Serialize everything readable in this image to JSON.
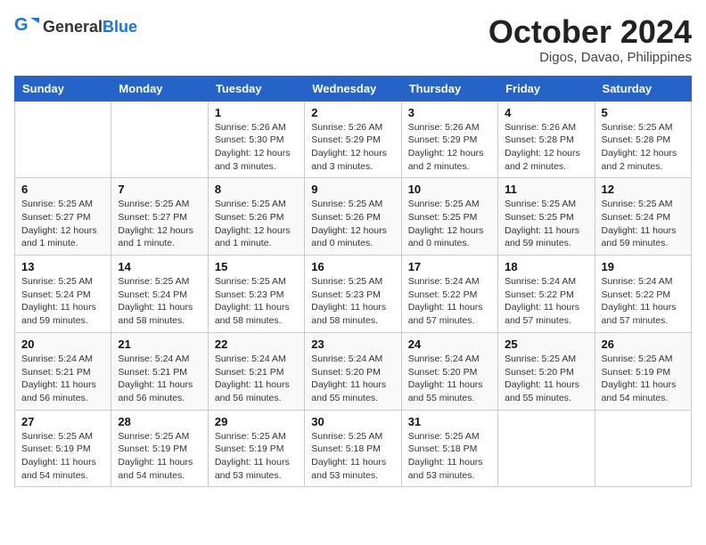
{
  "header": {
    "logo_general": "General",
    "logo_blue": "Blue",
    "month": "October 2024",
    "location": "Digos, Davao, Philippines"
  },
  "days_of_week": [
    "Sunday",
    "Monday",
    "Tuesday",
    "Wednesday",
    "Thursday",
    "Friday",
    "Saturday"
  ],
  "weeks": [
    [
      {
        "day": "",
        "info": ""
      },
      {
        "day": "",
        "info": ""
      },
      {
        "day": "1",
        "info": "Sunrise: 5:26 AM\nSunset: 5:30 PM\nDaylight: 12 hours and 3 minutes."
      },
      {
        "day": "2",
        "info": "Sunrise: 5:26 AM\nSunset: 5:29 PM\nDaylight: 12 hours and 3 minutes."
      },
      {
        "day": "3",
        "info": "Sunrise: 5:26 AM\nSunset: 5:29 PM\nDaylight: 12 hours and 2 minutes."
      },
      {
        "day": "4",
        "info": "Sunrise: 5:26 AM\nSunset: 5:28 PM\nDaylight: 12 hours and 2 minutes."
      },
      {
        "day": "5",
        "info": "Sunrise: 5:25 AM\nSunset: 5:28 PM\nDaylight: 12 hours and 2 minutes."
      }
    ],
    [
      {
        "day": "6",
        "info": "Sunrise: 5:25 AM\nSunset: 5:27 PM\nDaylight: 12 hours and 1 minute."
      },
      {
        "day": "7",
        "info": "Sunrise: 5:25 AM\nSunset: 5:27 PM\nDaylight: 12 hours and 1 minute."
      },
      {
        "day": "8",
        "info": "Sunrise: 5:25 AM\nSunset: 5:26 PM\nDaylight: 12 hours and 1 minute."
      },
      {
        "day": "9",
        "info": "Sunrise: 5:25 AM\nSunset: 5:26 PM\nDaylight: 12 hours and 0 minutes."
      },
      {
        "day": "10",
        "info": "Sunrise: 5:25 AM\nSunset: 5:25 PM\nDaylight: 12 hours and 0 minutes."
      },
      {
        "day": "11",
        "info": "Sunrise: 5:25 AM\nSunset: 5:25 PM\nDaylight: 11 hours and 59 minutes."
      },
      {
        "day": "12",
        "info": "Sunrise: 5:25 AM\nSunset: 5:24 PM\nDaylight: 11 hours and 59 minutes."
      }
    ],
    [
      {
        "day": "13",
        "info": "Sunrise: 5:25 AM\nSunset: 5:24 PM\nDaylight: 11 hours and 59 minutes."
      },
      {
        "day": "14",
        "info": "Sunrise: 5:25 AM\nSunset: 5:24 PM\nDaylight: 11 hours and 58 minutes."
      },
      {
        "day": "15",
        "info": "Sunrise: 5:25 AM\nSunset: 5:23 PM\nDaylight: 11 hours and 58 minutes."
      },
      {
        "day": "16",
        "info": "Sunrise: 5:25 AM\nSunset: 5:23 PM\nDaylight: 11 hours and 58 minutes."
      },
      {
        "day": "17",
        "info": "Sunrise: 5:24 AM\nSunset: 5:22 PM\nDaylight: 11 hours and 57 minutes."
      },
      {
        "day": "18",
        "info": "Sunrise: 5:24 AM\nSunset: 5:22 PM\nDaylight: 11 hours and 57 minutes."
      },
      {
        "day": "19",
        "info": "Sunrise: 5:24 AM\nSunset: 5:22 PM\nDaylight: 11 hours and 57 minutes."
      }
    ],
    [
      {
        "day": "20",
        "info": "Sunrise: 5:24 AM\nSunset: 5:21 PM\nDaylight: 11 hours and 56 minutes."
      },
      {
        "day": "21",
        "info": "Sunrise: 5:24 AM\nSunset: 5:21 PM\nDaylight: 11 hours and 56 minutes."
      },
      {
        "day": "22",
        "info": "Sunrise: 5:24 AM\nSunset: 5:21 PM\nDaylight: 11 hours and 56 minutes."
      },
      {
        "day": "23",
        "info": "Sunrise: 5:24 AM\nSunset: 5:20 PM\nDaylight: 11 hours and 55 minutes."
      },
      {
        "day": "24",
        "info": "Sunrise: 5:24 AM\nSunset: 5:20 PM\nDaylight: 11 hours and 55 minutes."
      },
      {
        "day": "25",
        "info": "Sunrise: 5:25 AM\nSunset: 5:20 PM\nDaylight: 11 hours and 55 minutes."
      },
      {
        "day": "26",
        "info": "Sunrise: 5:25 AM\nSunset: 5:19 PM\nDaylight: 11 hours and 54 minutes."
      }
    ],
    [
      {
        "day": "27",
        "info": "Sunrise: 5:25 AM\nSunset: 5:19 PM\nDaylight: 11 hours and 54 minutes."
      },
      {
        "day": "28",
        "info": "Sunrise: 5:25 AM\nSunset: 5:19 PM\nDaylight: 11 hours and 54 minutes."
      },
      {
        "day": "29",
        "info": "Sunrise: 5:25 AM\nSunset: 5:19 PM\nDaylight: 11 hours and 53 minutes."
      },
      {
        "day": "30",
        "info": "Sunrise: 5:25 AM\nSunset: 5:18 PM\nDaylight: 11 hours and 53 minutes."
      },
      {
        "day": "31",
        "info": "Sunrise: 5:25 AM\nSunset: 5:18 PM\nDaylight: 11 hours and 53 minutes."
      },
      {
        "day": "",
        "info": ""
      },
      {
        "day": "",
        "info": ""
      }
    ]
  ]
}
